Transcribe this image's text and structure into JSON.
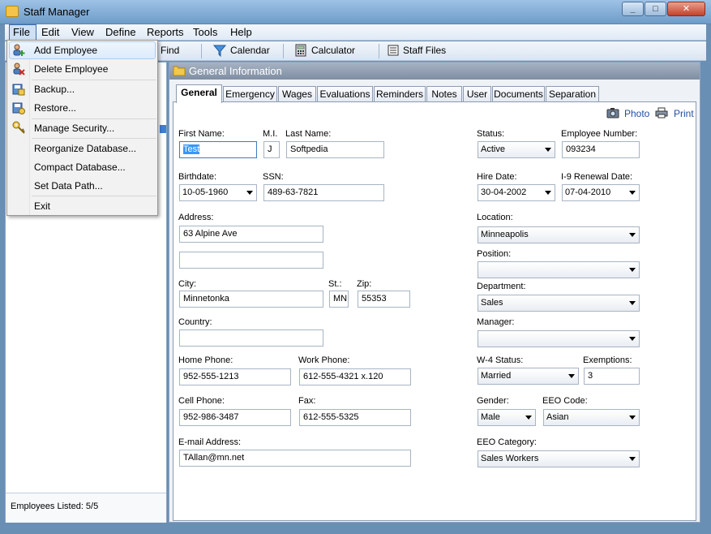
{
  "window": {
    "title": "Staff Manager"
  },
  "menubar": {
    "file": "File",
    "edit": "Edit",
    "view": "View",
    "define": "Define",
    "reports": "Reports",
    "tools": "Tools",
    "help": "Help"
  },
  "toolbar": {
    "find": "Find",
    "calendar": "Calendar",
    "calculator": "Calculator",
    "staff_files": "Staff Files"
  },
  "file_menu": {
    "items": [
      {
        "label": "Add Employee",
        "icon": "add-user-icon"
      },
      {
        "label": "Delete Employee",
        "icon": "delete-user-icon"
      },
      {
        "label": "Backup...",
        "icon": "backup-icon"
      },
      {
        "label": "Restore...",
        "icon": "restore-icon"
      },
      {
        "label": "Manage Security...",
        "icon": "key-icon"
      },
      {
        "label": "Reorganize Database..."
      },
      {
        "label": "Compact Database..."
      },
      {
        "label": "Set Data Path..."
      },
      {
        "label": "Exit"
      }
    ]
  },
  "left_pane": {
    "footer": "Employees Listed: 5/5"
  },
  "section": {
    "title": "General Information"
  },
  "tabs": [
    "General",
    "Emergency",
    "Wages",
    "Evaluations",
    "Reminders",
    "Notes",
    "User",
    "Documents",
    "Separation"
  ],
  "actions": {
    "photo": "Photo",
    "print": "Print"
  },
  "form": {
    "first_name": {
      "label": "First Name:",
      "value": "Test"
    },
    "mi": {
      "label": "M.I.",
      "value": "J"
    },
    "last_name": {
      "label": "Last Name:",
      "value": "Softpedia"
    },
    "birthdate": {
      "label": "Birthdate:",
      "value": "10-05-1960"
    },
    "ssn": {
      "label": "SSN:",
      "value": "489-63-7821"
    },
    "address": {
      "label": "Address:",
      "value": "63 Alpine Ave",
      "value2": ""
    },
    "city": {
      "label": "City:",
      "value": "Minnetonka"
    },
    "state": {
      "label": "St.:",
      "value": "MN"
    },
    "zip": {
      "label": "Zip:",
      "value": "55353"
    },
    "country": {
      "label": "Country:",
      "value": ""
    },
    "home_phone": {
      "label": "Home Phone:",
      "value": "952-555-1213"
    },
    "work_phone": {
      "label": "Work Phone:",
      "value": "612-555-4321 x.120"
    },
    "cell_phone": {
      "label": "Cell Phone:",
      "value": "952-986-3487"
    },
    "fax": {
      "label": "Fax:",
      "value": "612-555-5325"
    },
    "email": {
      "label": "E-mail Address:",
      "value": "TAllan@mn.net"
    },
    "status": {
      "label": "Status:",
      "value": "Active"
    },
    "employee_number": {
      "label": "Employee Number:",
      "value": "093234"
    },
    "hire_date": {
      "label": "Hire Date:",
      "value": "30-04-2002"
    },
    "i9_renewal": {
      "label": "I-9 Renewal Date:",
      "value": "07-04-2010"
    },
    "location": {
      "label": "Location:",
      "value": "Minneapolis"
    },
    "position": {
      "label": "Position:",
      "value": ""
    },
    "department": {
      "label": "Department:",
      "value": "Sales"
    },
    "manager": {
      "label": "Manager:",
      "value": ""
    },
    "w4_status": {
      "label": "W-4 Status:",
      "value": "Married"
    },
    "exemptions": {
      "label": "Exemptions:",
      "value": "3"
    },
    "gender": {
      "label": "Gender:",
      "value": "Male"
    },
    "eeo_code": {
      "label": "EEO Code:",
      "value": "Asian"
    },
    "eeo_category": {
      "label": "EEO Category:",
      "value": "Sales Workers"
    }
  },
  "colors": {
    "accent": "#3399ff",
    "title_bar": "#9ec2e6",
    "section_header": "#8f9db0"
  }
}
